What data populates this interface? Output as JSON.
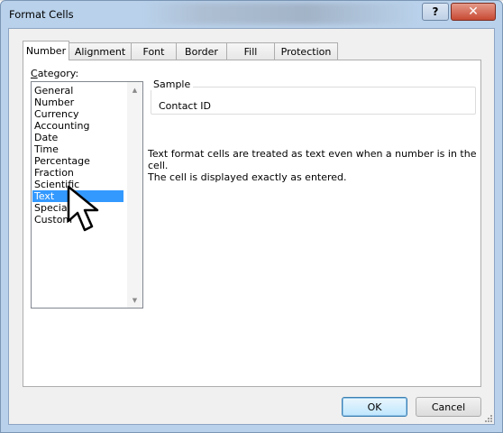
{
  "window": {
    "title": "Format Cells",
    "help_glyph": "?",
    "close_glyph": "✕"
  },
  "tabs": [
    {
      "label": "Number",
      "active": true
    },
    {
      "label": "Alignment",
      "active": false
    },
    {
      "label": "Font",
      "active": false
    },
    {
      "label": "Border",
      "active": false
    },
    {
      "label": "Fill",
      "active": false
    },
    {
      "label": "Protection",
      "active": false
    }
  ],
  "category": {
    "label_first": "C",
    "label_rest": "ategory:",
    "items": [
      "General",
      "Number",
      "Currency",
      "Accounting",
      "Date",
      "Time",
      "Percentage",
      "Fraction",
      "Scientific",
      "Text",
      "Special",
      "Custom"
    ],
    "selected": "Text"
  },
  "sample": {
    "legend": "Sample",
    "value": "Contact ID"
  },
  "description": {
    "line1": "Text format cells are treated as text even when a number is in the cell.",
    "line2": "The cell is displayed exactly as entered."
  },
  "buttons": {
    "ok": "OK",
    "cancel": "Cancel"
  },
  "icons": {
    "scroll_up": "▲",
    "scroll_down": "▼"
  },
  "colors": {
    "selection": "#3399ff",
    "title_bar": "#b9d1ea",
    "close_button": "#c84a34"
  }
}
